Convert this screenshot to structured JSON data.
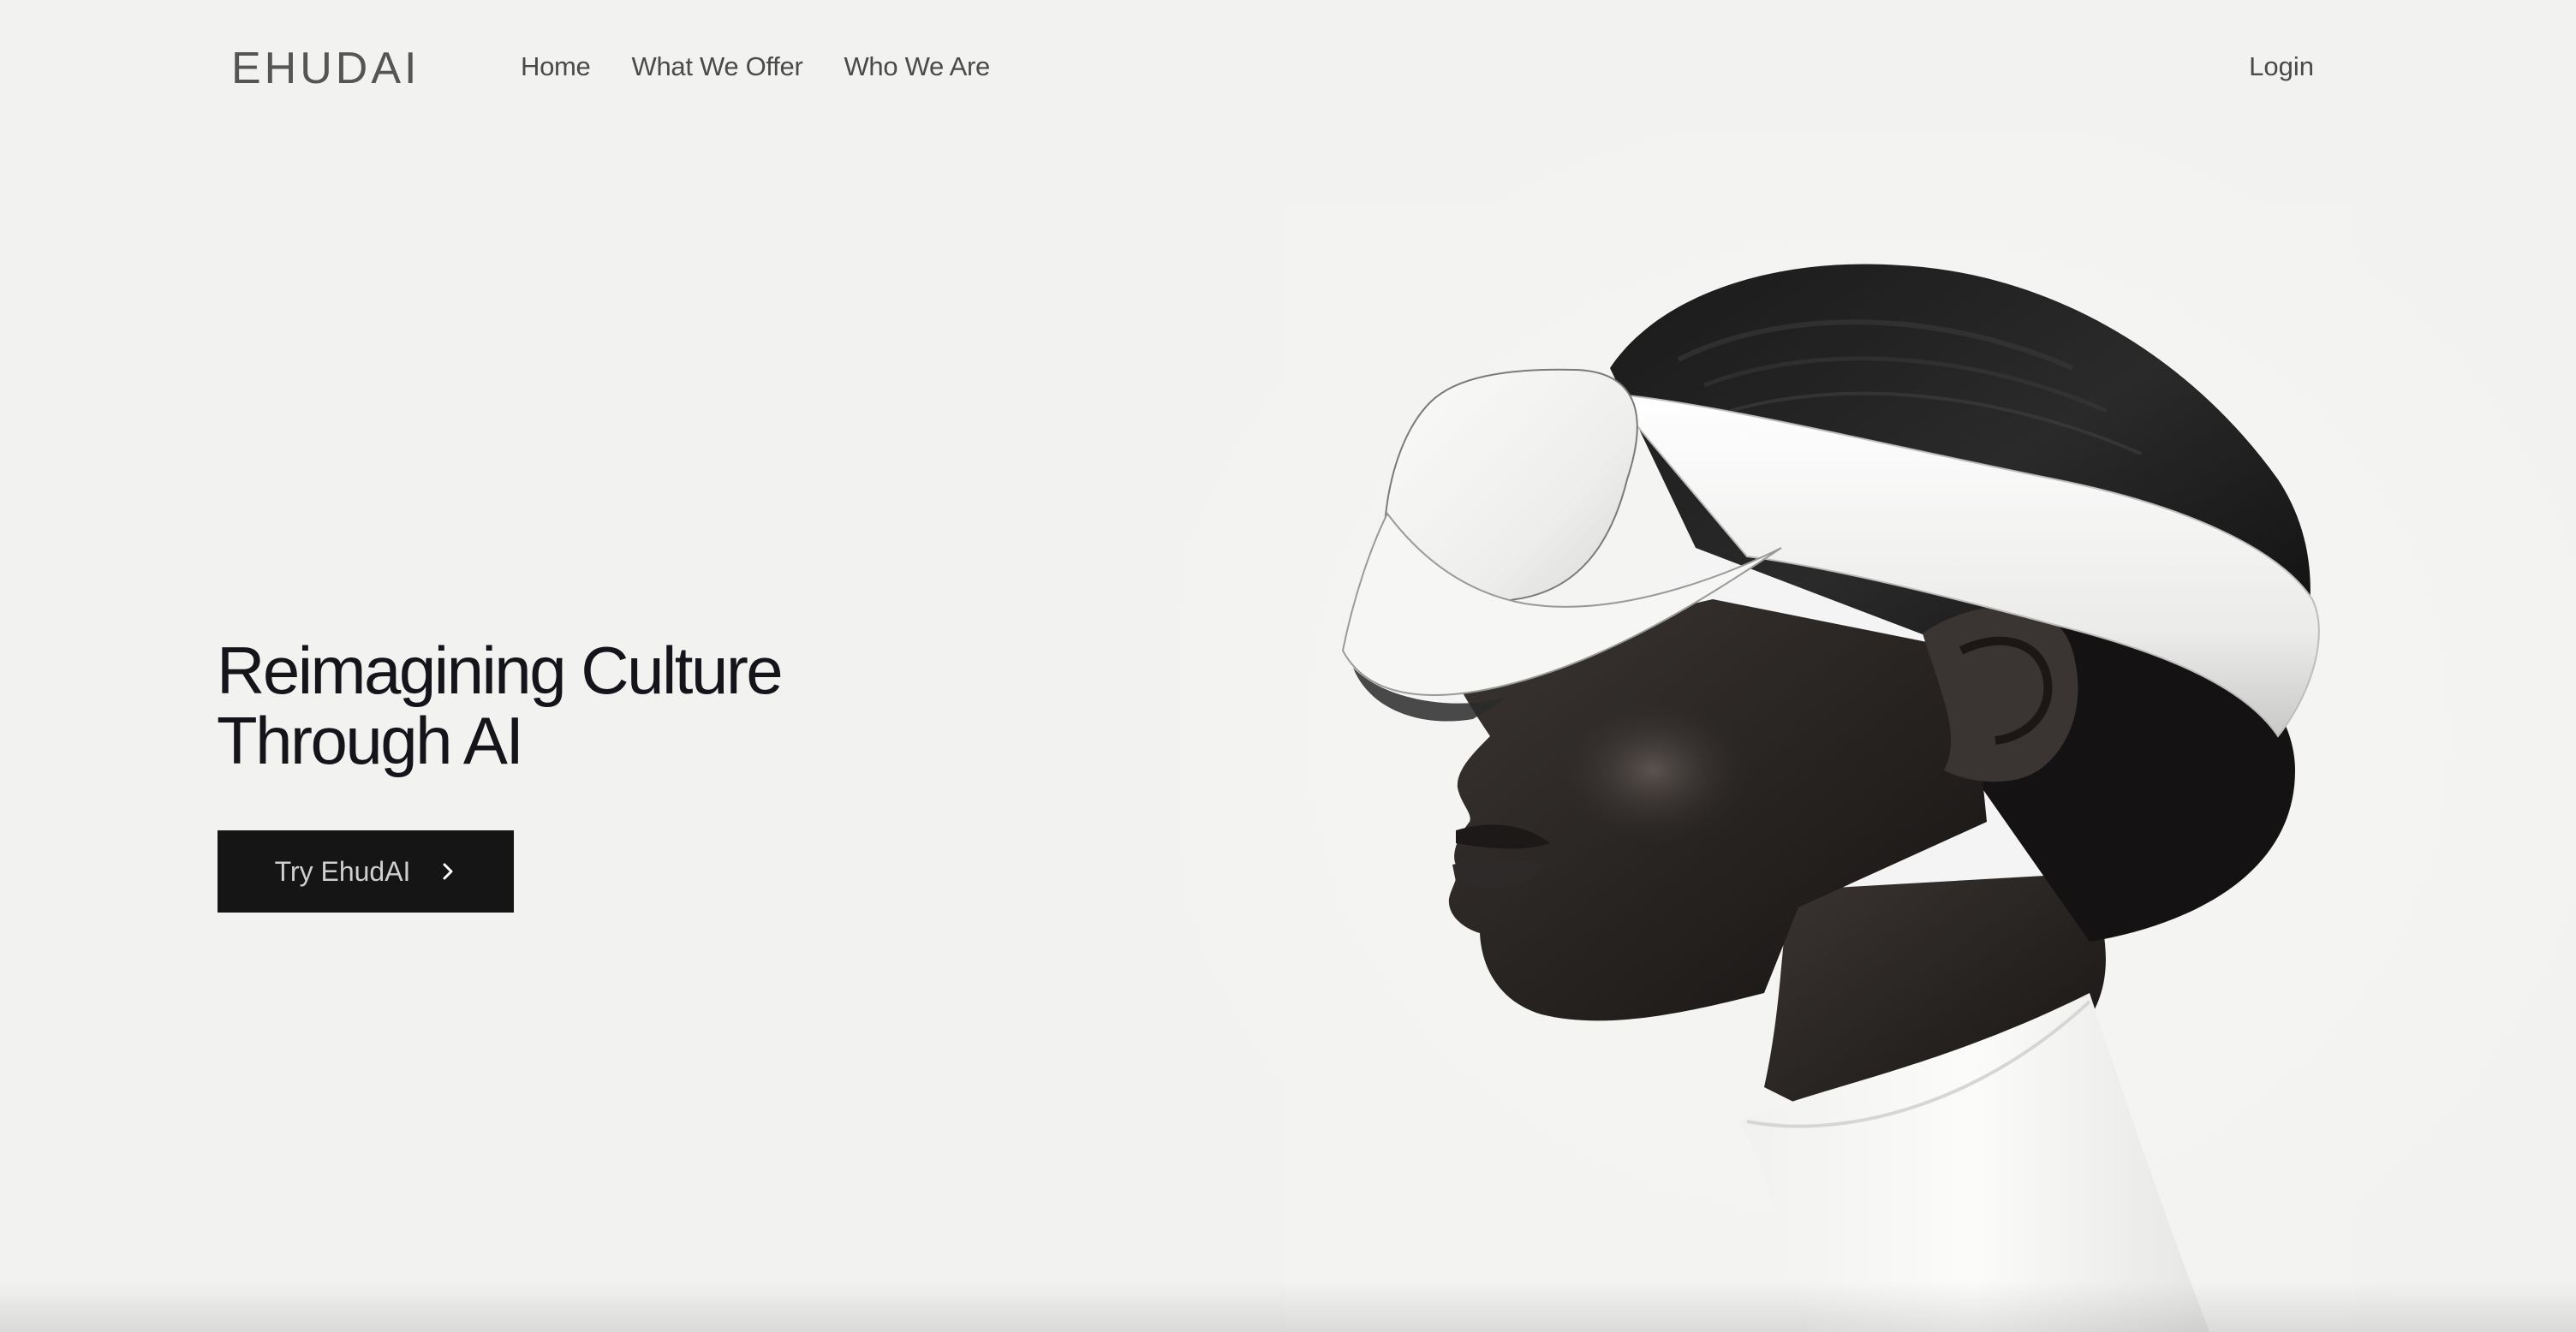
{
  "brand": {
    "logo_text": "EHUDAI"
  },
  "nav": {
    "items": [
      {
        "label": "Home"
      },
      {
        "label": "What We Offer"
      },
      {
        "label": "Who We Are"
      }
    ],
    "login_label": "Login"
  },
  "hero": {
    "title_line1": "Reimagining Culture",
    "title_line2": "Through AI",
    "cta_label": "Try EhudAI",
    "cta_icon": "chevron-right-icon",
    "image_subject": "profile portrait of a woman wearing a white VR headset"
  },
  "colors": {
    "background": "#f2f2f0",
    "text": "#14141a",
    "button_bg": "#151515",
    "button_text": "#cfcfcf"
  }
}
